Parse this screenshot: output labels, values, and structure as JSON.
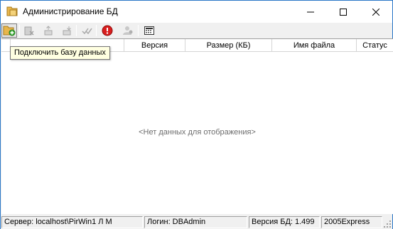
{
  "window": {
    "title": "Администрирование БД"
  },
  "toolbar": {
    "buttons": [
      {
        "name": "connect-database-icon",
        "state": "active"
      },
      {
        "name": "disconnect-database-icon",
        "state": "disabled"
      },
      {
        "name": "backup-database-icon",
        "state": "disabled"
      },
      {
        "name": "restore-database-icon",
        "state": "disabled"
      },
      {
        "name": "check-database-icon",
        "state": "disabled"
      },
      {
        "name": "stop-server-icon",
        "state": "enabled"
      },
      {
        "name": "users-icon",
        "state": "disabled"
      },
      {
        "name": "settings-icon",
        "state": "enabled"
      }
    ],
    "tooltip": "Подключить базу данных"
  },
  "grid": {
    "columns": [
      "",
      "",
      "Версия",
      "Размер (КБ)",
      "Имя файла",
      "Статус"
    ],
    "empty_message": "<Нет данных для отображения>"
  },
  "statusbar": {
    "server": "Сервер: localhost\\PirWin1 Л М",
    "login": "Логин: DBAdmin",
    "db_version": "Версия БД: 1.499",
    "edition": "2005Express"
  },
  "colors": {
    "window_border": "#2b78c8",
    "tooltip_bg": "#ffffe1",
    "empty_text": "#6d6d6d",
    "stop_icon": "#d81e1e"
  }
}
